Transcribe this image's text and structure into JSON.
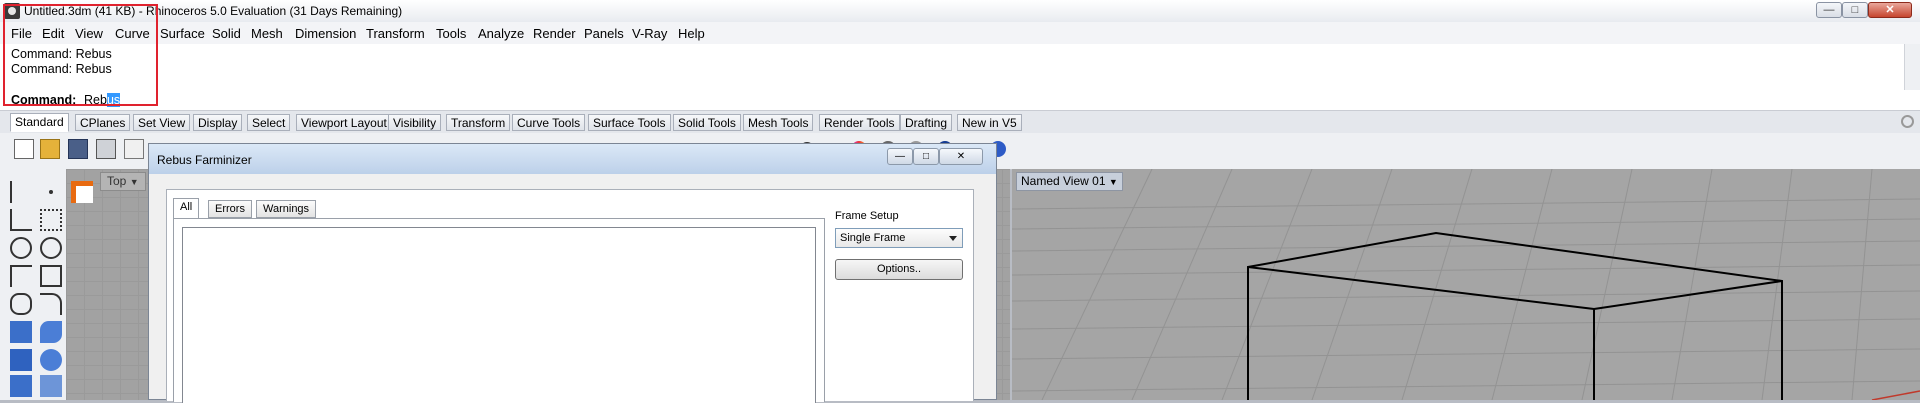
{
  "window": {
    "title": "Untitled.3dm (41 KB) - Rhinoceros 5.0 Evaluation (31 Days Remaining)"
  },
  "menu": [
    "File",
    "Edit",
    "View",
    "Curve",
    "Surface",
    "Solid",
    "Mesh",
    "Dimension",
    "Transform",
    "Tools",
    "Analyze",
    "Render",
    "Panels",
    "V-Ray",
    "Help"
  ],
  "command": {
    "history": [
      "Command: Rebus",
      "Command: Rebus"
    ],
    "prompt_label": "Command:",
    "input_plain": "Reb",
    "input_selected": "us"
  },
  "toolbar_tabs": [
    "Standard",
    "CPlanes",
    "Set View",
    "Display",
    "Select",
    "Viewport Layout",
    "Visibility",
    "Transform",
    "Curve Tools",
    "Surface Tools",
    "Solid Tools",
    "Mesh Tools",
    "Render Tools",
    "Drafting",
    "New in V5"
  ],
  "active_toolbar_tab": "Standard",
  "viewports": {
    "left_label": "Top",
    "right_label": "Named View 01"
  },
  "dialog": {
    "title": "Rebus Farminizer",
    "tabs": [
      "All",
      "Errors",
      "Warnings"
    ],
    "active_tab": "All",
    "frame_setup_label": "Frame Setup",
    "frame_mode": "Single Frame",
    "options_label": "Options.."
  },
  "colors": {
    "highlight_box": "#e0222e",
    "selection": "#3399ff",
    "cplane_marker": "#e86a10"
  }
}
